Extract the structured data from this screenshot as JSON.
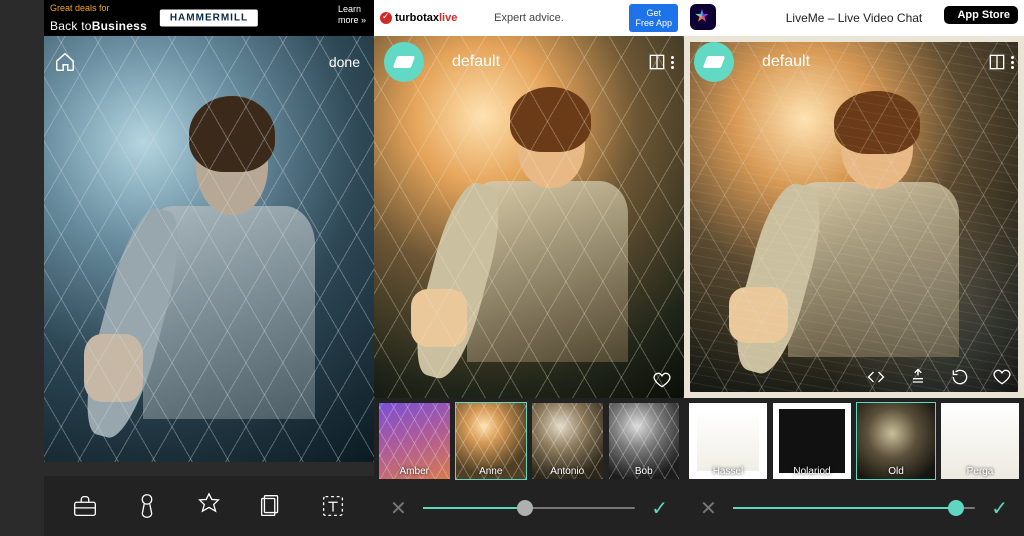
{
  "phone1": {
    "ad": {
      "tagline": "Great deals for",
      "brand_light": "Back to",
      "brand_bold": "Business",
      "pill": "HAMMERMILL",
      "learn1": "Learn",
      "learn2": "more »"
    },
    "done": "done",
    "tools": [
      "toolbox",
      "brush",
      "magic",
      "layers",
      "text"
    ]
  },
  "phone2": {
    "ad": {
      "tt1": "turbotax",
      "tt2": "live",
      "mid": "Expert advice.",
      "cta1": "Get",
      "cta2": "Free App"
    },
    "title": "default",
    "filters": [
      {
        "key": "amber",
        "label": "Amber"
      },
      {
        "key": "anne",
        "label": "Anne"
      },
      {
        "key": "antonio",
        "label": "Antonio"
      },
      {
        "key": "bob",
        "label": "Bob"
      }
    ],
    "selected_filter": 1,
    "slider_pct": 48
  },
  "phone3": {
    "ad": {
      "text": "LiveMe – Live Video Chat",
      "store": "App Store"
    },
    "title": "default",
    "filters": [
      {
        "key": "hassel",
        "label": "Hassel"
      },
      {
        "key": "nolariod",
        "label": "Nolariod"
      },
      {
        "key": "old",
        "label": "Old"
      },
      {
        "key": "perga",
        "label": "Perga"
      }
    ],
    "selected_filter": 2,
    "slider_pct": 92
  }
}
